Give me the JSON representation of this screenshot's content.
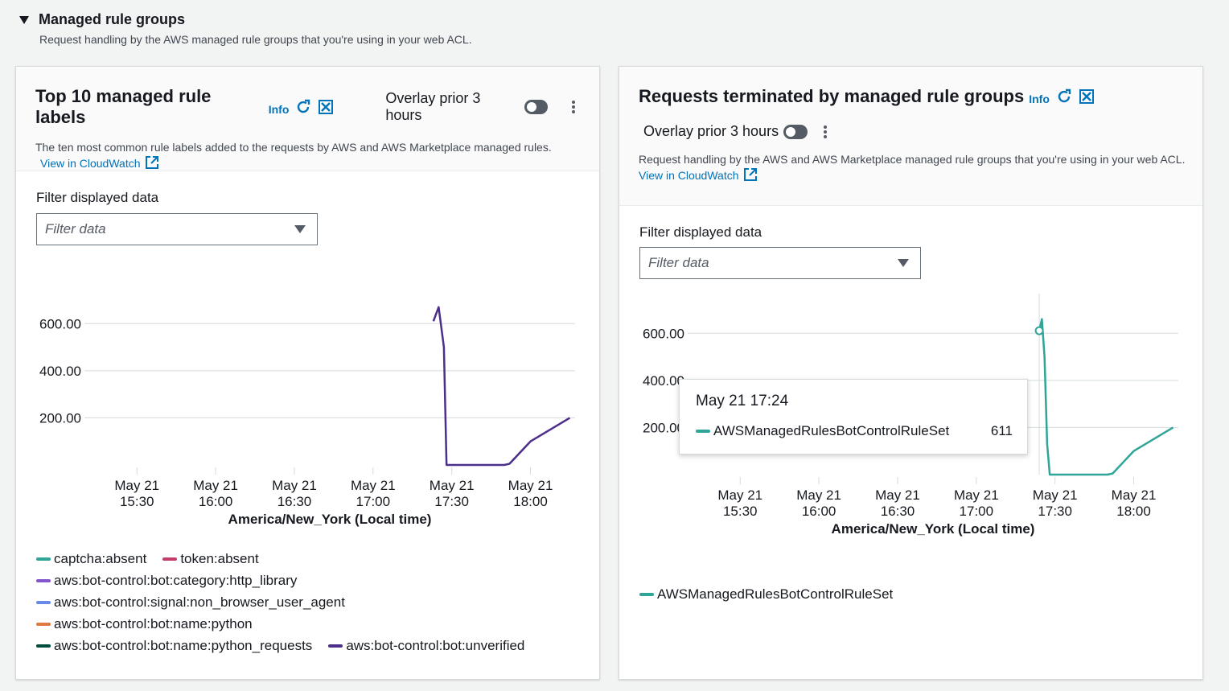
{
  "section": {
    "title": "Managed rule groups",
    "description": "Request handling by the AWS managed rule groups that you're using in your web ACL."
  },
  "panels": [
    {
      "title": "Top 10 managed rule labels",
      "info": "Info",
      "overlay_label": "Overlay prior 3 hours",
      "description": "The ten most common rule labels added to the requests by AWS and AWS Marketplace managed rules.",
      "link": "View in CloudWatch",
      "filter_label": "Filter displayed data",
      "filter_placeholder": "Filter data",
      "x_axis_title": "America/New_York (Local time)",
      "legend": [
        {
          "label": "captcha:absent",
          "color": "#2ea597"
        },
        {
          "label": "token:absent",
          "color": "#c33d69"
        },
        {
          "label": "aws:bot-control:bot:category:http_library",
          "color": "#8456ce"
        },
        {
          "label": "aws:bot-control:signal:non_browser_user_agent",
          "color": "#688ae8"
        },
        {
          "label": "aws:bot-control:bot:name:python",
          "color": "#e07941"
        },
        {
          "label": "aws:bot-control:bot:name:python_requests",
          "color": "#004d40"
        },
        {
          "label": "aws:bot-control:bot:unverified",
          "color": "#4b2f8a"
        }
      ]
    },
    {
      "title": "Requests terminated by managed rule groups",
      "info": "Info",
      "overlay_label": "Overlay prior 3 hours",
      "description": "Request handling by the AWS and AWS Marketplace managed rule groups that you're using in your web ACL.",
      "link": "View in CloudWatch",
      "filter_label": "Filter displayed data",
      "filter_placeholder": "Filter data",
      "x_axis_title": "America/New_York (Local time)",
      "legend": [
        {
          "label": "AWSManagedRulesBotControlRuleSet",
          "color": "#2ea597"
        }
      ],
      "tooltip": {
        "time": "May 21 17:24",
        "series": "AWSManagedRulesBotControlRuleSet",
        "value": "611"
      }
    }
  ],
  "chart_data": [
    {
      "type": "line",
      "title": "Top 10 managed rule labels",
      "xlabel": "America/New_York (Local time)",
      "ylabel": "",
      "x_ticks": [
        "May 21\n15:30",
        "May 21\n16:00",
        "May 21\n16:30",
        "May 21\n17:00",
        "May 21\n17:30",
        "May 21\n18:00"
      ],
      "y_ticks": [
        "200.00",
        "400.00",
        "600.00"
      ],
      "ylim": [
        0,
        700
      ],
      "series": [
        {
          "name": "aws:bot-control:bot:unverified",
          "color": "#4b2f8a",
          "x": [
            "17:23",
            "17:24",
            "17:25",
            "17:27",
            "17:28",
            "17:50",
            "17:52",
            "18:00",
            "18:15"
          ],
          "y": [
            610,
            640,
            670,
            500,
            0,
            0,
            5,
            100,
            200
          ]
        }
      ]
    },
    {
      "type": "line",
      "title": "Requests terminated by managed rule groups",
      "xlabel": "America/New_York (Local time)",
      "ylabel": "",
      "x_ticks": [
        "May 21\n15:30",
        "May 21\n16:00",
        "May 21\n16:30",
        "May 21\n17:00",
        "May 21\n17:30",
        "May 21\n18:00"
      ],
      "y_ticks": [
        "200.00",
        "400.00",
        "600.00"
      ],
      "ylim": [
        0,
        700
      ],
      "series": [
        {
          "name": "AWSManagedRulesBotControlRuleSet",
          "color": "#2ea597",
          "x": [
            "17:24",
            "17:25",
            "17:26",
            "17:27",
            "17:28",
            "17:50",
            "17:52",
            "18:00",
            "18:15"
          ],
          "y": [
            611,
            660,
            500,
            130,
            0,
            0,
            5,
            100,
            200
          ]
        }
      ]
    }
  ]
}
